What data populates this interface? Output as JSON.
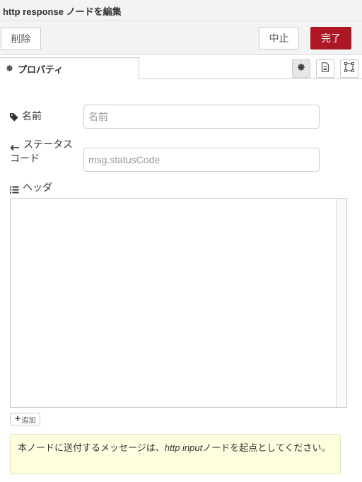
{
  "window": {
    "title": "http response ノードを編集"
  },
  "toolbar": {
    "delete_label": "削除",
    "cancel_label": "中止",
    "done_label": "完了"
  },
  "tabs": [
    {
      "label": "プロパティ",
      "icon": "gear-icon"
    }
  ],
  "tab_icons": [
    "gear-icon",
    "document-icon",
    "frame-icon"
  ],
  "form": {
    "name": {
      "label": "名前",
      "icon": "tag-icon",
      "placeholder": "名前",
      "value": ""
    },
    "status": {
      "label_line1": "ステータス",
      "label_line2": "コード",
      "icon": "arrow-left-icon",
      "placeholder": "msg.statusCode",
      "value": ""
    },
    "headers": {
      "label": "ヘッダ",
      "icon": "list-icon",
      "add_label": "追加",
      "rows": []
    }
  },
  "note": {
    "text_before": "本ノードに送付するメッセージは、",
    "text_em": "http input",
    "text_after": "ノードを起点としてください。"
  },
  "colors": {
    "accent": "#ad1625",
    "panel_bg": "#f3f3f3",
    "note_bg": "#ffffe0"
  }
}
